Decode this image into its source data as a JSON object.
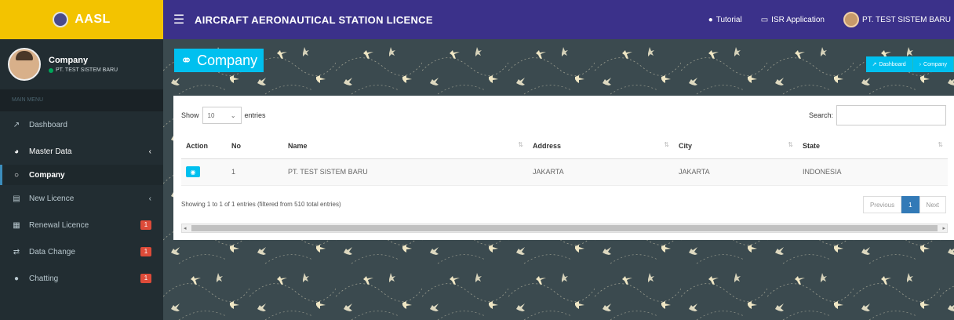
{
  "brand": {
    "logo_text": "AASL"
  },
  "header": {
    "title": "AIRCRAFT AERONAUTICAL STATION LICENCE",
    "tutorial": "Tutorial",
    "isr": "ISR Application",
    "company": "PT. TEST SISTEM BARU"
  },
  "user": {
    "name": "Company",
    "sub": "PT. TEST SISTEM BARU"
  },
  "menu": {
    "header": "MAIN MENU",
    "items": [
      {
        "label": "Dashboard"
      },
      {
        "label": "Master Data"
      },
      {
        "label": "Company"
      },
      {
        "label": "New Licence"
      },
      {
        "label": "Renewal Licence",
        "badge": "1"
      },
      {
        "label": "Data Change",
        "badge": "1"
      },
      {
        "label": "Chatting",
        "badge": "1"
      }
    ]
  },
  "page": {
    "title": "Company",
    "breadcrumb": [
      "Dashboard",
      "Company"
    ]
  },
  "table": {
    "show_label": "Show",
    "length_value": "10",
    "entries_label": "entries",
    "search_label": "Search:",
    "columns": [
      "Action",
      "No",
      "Name",
      "Address",
      "City",
      "State"
    ],
    "rows": [
      {
        "no": "1",
        "name": "PT. TEST SISTEM BARU",
        "address": "JAKARTA",
        "city": "JAKARTA",
        "state": "INDONESIA"
      }
    ],
    "info": "Showing 1 to 1 of 1 entries (filtered from 510 total entries)",
    "pagination": {
      "previous": "Previous",
      "current": "1",
      "next": "Next"
    }
  },
  "colors": {
    "header": "#3b318a",
    "logo": "#f3c300",
    "sidebar": "#222d32",
    "accent": "#00c0ef"
  }
}
